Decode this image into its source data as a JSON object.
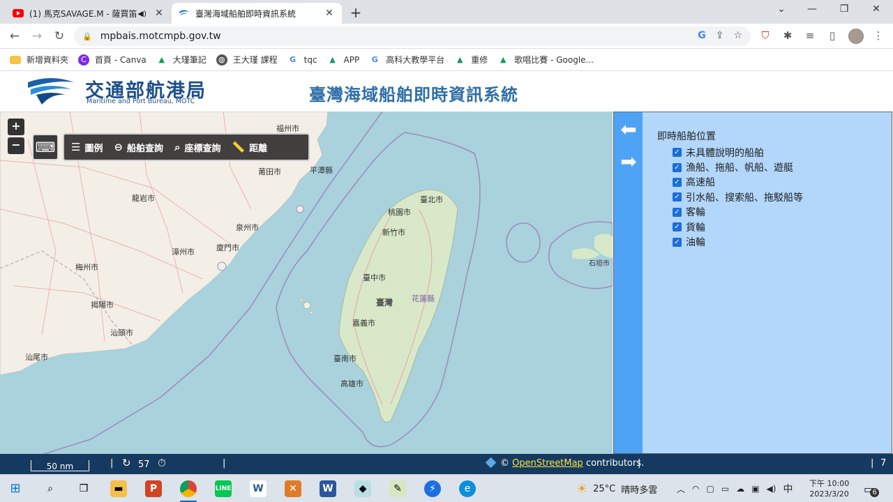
{
  "browser": {
    "tabs": [
      {
        "title": "(1) 馬克SAVAGE.M - 薩買笛",
        "active": false
      },
      {
        "title": "臺灣海域船舶即時資訊系統",
        "active": true
      }
    ],
    "url": "mpbais.motcmpb.gov.tw",
    "bookmarks": [
      "新增資料夾",
      "首頁 - Canva",
      "大瑾筆記",
      "王大瑾 課程",
      "tqc",
      "APP",
      "高科大教學平台",
      "重修",
      "歌唱比賽 - Google..."
    ]
  },
  "site": {
    "logo_cn": "交通部航港局",
    "logo_en": "Maritime and Port Bureau, MOTC",
    "title": "臺灣海域船舶即時資訊系統"
  },
  "map": {
    "zoom_in": "+",
    "zoom_out": "−",
    "toolbar": [
      {
        "label": "圖例",
        "icon": "list-icon"
      },
      {
        "label": "船舶查詢",
        "icon": "zoom-out-icon"
      },
      {
        "label": "座標查詢",
        "icon": "location-search-icon"
      },
      {
        "label": "距離",
        "icon": "ruler-icon"
      }
    ],
    "labels": {
      "taiwan": "臺灣",
      "taipei": "臺北市",
      "taoyuan": "桃園市",
      "hsinchu": "新竹市",
      "taichung": "臺中市",
      "chiayi": "嘉義市",
      "tainan": "臺南市",
      "kaohsiung": "高雄市",
      "hualien": "花蓮縣",
      "fuzhou": "福州市",
      "putian": "莆田市",
      "pingtan": "平潭縣",
      "quanzhou": "泉州市",
      "xiamen": "廈門市",
      "zhangzhou": "漳州市",
      "longyan": "龍岩市",
      "shantou": "汕頭市",
      "jieyang": "揭陽市",
      "meizhou": "梅州市",
      "shanwei": "汕尾市",
      "ishigaki": "石垣市"
    }
  },
  "panel": {
    "heading": "即時船舶位置",
    "items": [
      "未具體說明的船舶",
      "漁船、拖船、帆船、遊艇",
      "高速船",
      "引水船、搜索船、拖駁船等",
      "客輪",
      "貨輪",
      "油輪"
    ]
  },
  "status": {
    "scale": "50 nm",
    "refresh_count": "57",
    "attribution_prefix": "©",
    "attribution_link": "OpenStreetMap",
    "attribution_suffix": "contributors.",
    "zoom_level": "7"
  },
  "taskbar": {
    "weather_temp": "25°C",
    "weather_desc": "晴時多雲",
    "ime": "中",
    "time": "下午 10:00",
    "date": "2023/3/20",
    "notifications": "6"
  }
}
